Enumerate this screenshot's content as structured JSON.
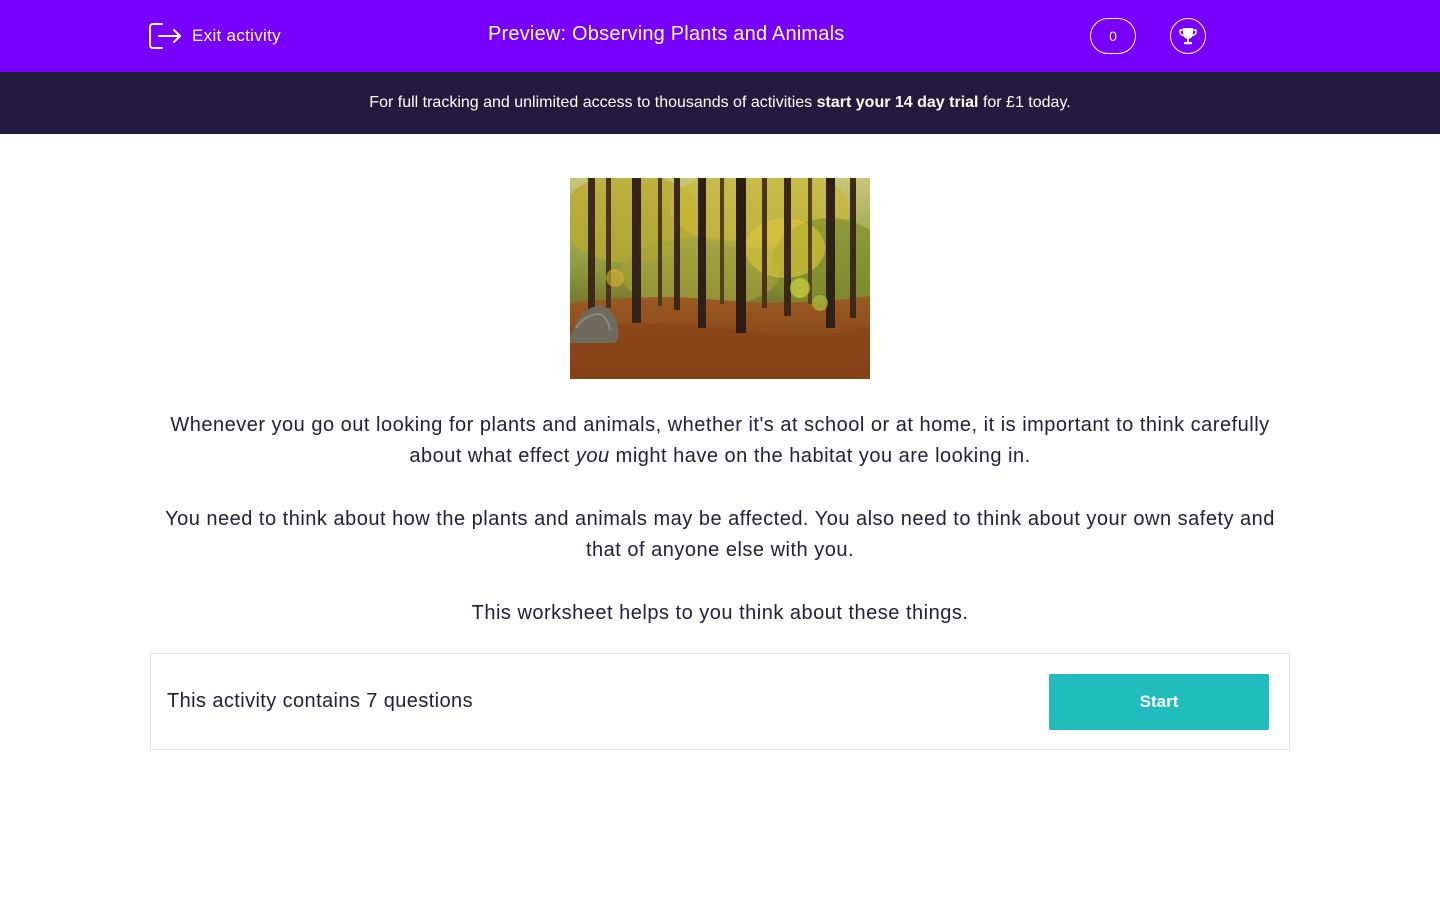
{
  "header": {
    "exit_label": "Exit activity",
    "exit_icon": "exit-icon",
    "title": "Preview: Observing Plants and Animals",
    "score": "0",
    "trophy_icon": "trophy-icon",
    "background_color": "#7700ff"
  },
  "banner": {
    "text_before": "For full tracking and unlimited access to thousands of activities ",
    "cta": "start your 14 day trial",
    "text_after": " for £1 today.",
    "background_color": "#231b3d"
  },
  "hero_image": {
    "alt": "Autumn forest with tall trees and fallen leaves"
  },
  "intro": {
    "p1_before": "Whenever you go out looking for plants and animals, whether it's at school or at home, it is important to think carefully about what effect ",
    "p1_emphasis": "you",
    "p1_after": " might have on the habitat you are looking in.",
    "p2": "You need to think about how the plants and animals may be affected. You also need to think about your own safety and that of anyone else with you.",
    "p3": "This worksheet helps to you think about these things."
  },
  "activity": {
    "summary": "This activity contains 7 questions",
    "start_label": "Start",
    "accent_color": "#21bcbe"
  }
}
